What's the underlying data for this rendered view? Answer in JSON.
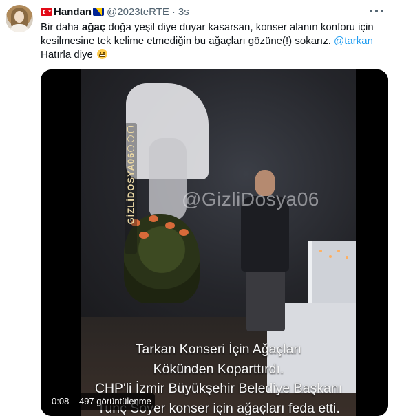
{
  "tweet": {
    "display_name": "Handan",
    "handle": "@2023teRTE",
    "separator": "·",
    "time": "3s",
    "text": {
      "part1": "Bir daha ",
      "bold": "ağaç",
      "part2": " doğa yeşil diye duyar kasarsan, konser alanın konforu için kesilmesine tek kelime etmediğin bu ağaçları gözüne(!) sokarız. ",
      "mention": "@tarkan",
      "line3": "Hatırla diye"
    },
    "icons": [
      "turkey-flag",
      "bosnia-flag",
      "grinning-face-emoji",
      "more-icon"
    ]
  },
  "video": {
    "watermark_vertical": "GİZLİDOSYA06",
    "watermark_center": "@GizliDosya06",
    "caption_lines": [
      "Tarkan Konseri İçin Ağaçları",
      "Kökünden Koparttırdı.",
      "CHP'li İzmir Büyükşehir Belediye Başkanı",
      "Tunç Soyer konser için ağaçları feda etti."
    ],
    "duration": "0:08",
    "views": "497 görüntülenme"
  }
}
